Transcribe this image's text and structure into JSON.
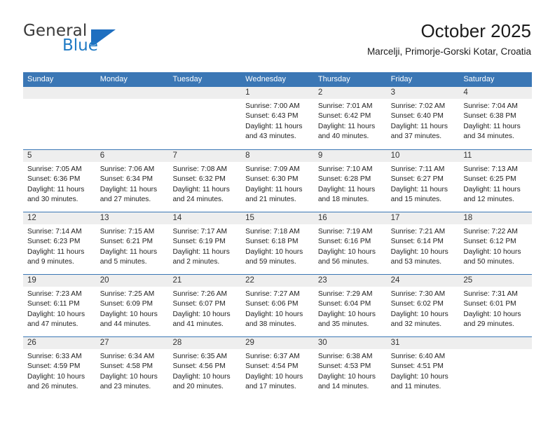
{
  "brand": {
    "name_dark": "General",
    "name_blue": "Blue",
    "mark": "triangle-logo",
    "color_dark": "#3a3a3a",
    "color_blue": "#1f7ac4"
  },
  "header": {
    "title": "October 2025",
    "subtitle": "Marcelji, Primorje-Gorski Kotar, Croatia"
  },
  "theme": {
    "header_blue": "#3b77b5",
    "daynum_band": "#eeeeee",
    "text": "#222222"
  },
  "calendar": {
    "weekday_headers": [
      "Sunday",
      "Monday",
      "Tuesday",
      "Wednesday",
      "Thursday",
      "Friday",
      "Saturday"
    ],
    "labels": {
      "sunrise": "Sunrise:",
      "sunset": "Sunset:",
      "daylight": "Daylight:"
    },
    "weeks": [
      [
        {
          "day": "",
          "sunrise": "",
          "sunset": "",
          "daylight": ""
        },
        {
          "day": "",
          "sunrise": "",
          "sunset": "",
          "daylight": ""
        },
        {
          "day": "",
          "sunrise": "",
          "sunset": "",
          "daylight": ""
        },
        {
          "day": "1",
          "sunrise": "Sunrise: 7:00 AM",
          "sunset": "Sunset: 6:43 PM",
          "daylight": "Daylight: 11 hours and 43 minutes."
        },
        {
          "day": "2",
          "sunrise": "Sunrise: 7:01 AM",
          "sunset": "Sunset: 6:42 PM",
          "daylight": "Daylight: 11 hours and 40 minutes."
        },
        {
          "day": "3",
          "sunrise": "Sunrise: 7:02 AM",
          "sunset": "Sunset: 6:40 PM",
          "daylight": "Daylight: 11 hours and 37 minutes."
        },
        {
          "day": "4",
          "sunrise": "Sunrise: 7:04 AM",
          "sunset": "Sunset: 6:38 PM",
          "daylight": "Daylight: 11 hours and 34 minutes."
        }
      ],
      [
        {
          "day": "5",
          "sunrise": "Sunrise: 7:05 AM",
          "sunset": "Sunset: 6:36 PM",
          "daylight": "Daylight: 11 hours and 30 minutes."
        },
        {
          "day": "6",
          "sunrise": "Sunrise: 7:06 AM",
          "sunset": "Sunset: 6:34 PM",
          "daylight": "Daylight: 11 hours and 27 minutes."
        },
        {
          "day": "7",
          "sunrise": "Sunrise: 7:08 AM",
          "sunset": "Sunset: 6:32 PM",
          "daylight": "Daylight: 11 hours and 24 minutes."
        },
        {
          "day": "8",
          "sunrise": "Sunrise: 7:09 AM",
          "sunset": "Sunset: 6:30 PM",
          "daylight": "Daylight: 11 hours and 21 minutes."
        },
        {
          "day": "9",
          "sunrise": "Sunrise: 7:10 AM",
          "sunset": "Sunset: 6:28 PM",
          "daylight": "Daylight: 11 hours and 18 minutes."
        },
        {
          "day": "10",
          "sunrise": "Sunrise: 7:11 AM",
          "sunset": "Sunset: 6:27 PM",
          "daylight": "Daylight: 11 hours and 15 minutes."
        },
        {
          "day": "11",
          "sunrise": "Sunrise: 7:13 AM",
          "sunset": "Sunset: 6:25 PM",
          "daylight": "Daylight: 11 hours and 12 minutes."
        }
      ],
      [
        {
          "day": "12",
          "sunrise": "Sunrise: 7:14 AM",
          "sunset": "Sunset: 6:23 PM",
          "daylight": "Daylight: 11 hours and 9 minutes."
        },
        {
          "day": "13",
          "sunrise": "Sunrise: 7:15 AM",
          "sunset": "Sunset: 6:21 PM",
          "daylight": "Daylight: 11 hours and 5 minutes."
        },
        {
          "day": "14",
          "sunrise": "Sunrise: 7:17 AM",
          "sunset": "Sunset: 6:19 PM",
          "daylight": "Daylight: 11 hours and 2 minutes."
        },
        {
          "day": "15",
          "sunrise": "Sunrise: 7:18 AM",
          "sunset": "Sunset: 6:18 PM",
          "daylight": "Daylight: 10 hours and 59 minutes."
        },
        {
          "day": "16",
          "sunrise": "Sunrise: 7:19 AM",
          "sunset": "Sunset: 6:16 PM",
          "daylight": "Daylight: 10 hours and 56 minutes."
        },
        {
          "day": "17",
          "sunrise": "Sunrise: 7:21 AM",
          "sunset": "Sunset: 6:14 PM",
          "daylight": "Daylight: 10 hours and 53 minutes."
        },
        {
          "day": "18",
          "sunrise": "Sunrise: 7:22 AM",
          "sunset": "Sunset: 6:12 PM",
          "daylight": "Daylight: 10 hours and 50 minutes."
        }
      ],
      [
        {
          "day": "19",
          "sunrise": "Sunrise: 7:23 AM",
          "sunset": "Sunset: 6:11 PM",
          "daylight": "Daylight: 10 hours and 47 minutes."
        },
        {
          "day": "20",
          "sunrise": "Sunrise: 7:25 AM",
          "sunset": "Sunset: 6:09 PM",
          "daylight": "Daylight: 10 hours and 44 minutes."
        },
        {
          "day": "21",
          "sunrise": "Sunrise: 7:26 AM",
          "sunset": "Sunset: 6:07 PM",
          "daylight": "Daylight: 10 hours and 41 minutes."
        },
        {
          "day": "22",
          "sunrise": "Sunrise: 7:27 AM",
          "sunset": "Sunset: 6:06 PM",
          "daylight": "Daylight: 10 hours and 38 minutes."
        },
        {
          "day": "23",
          "sunrise": "Sunrise: 7:29 AM",
          "sunset": "Sunset: 6:04 PM",
          "daylight": "Daylight: 10 hours and 35 minutes."
        },
        {
          "day": "24",
          "sunrise": "Sunrise: 7:30 AM",
          "sunset": "Sunset: 6:02 PM",
          "daylight": "Daylight: 10 hours and 32 minutes."
        },
        {
          "day": "25",
          "sunrise": "Sunrise: 7:31 AM",
          "sunset": "Sunset: 6:01 PM",
          "daylight": "Daylight: 10 hours and 29 minutes."
        }
      ],
      [
        {
          "day": "26",
          "sunrise": "Sunrise: 6:33 AM",
          "sunset": "Sunset: 4:59 PM",
          "daylight": "Daylight: 10 hours and 26 minutes."
        },
        {
          "day": "27",
          "sunrise": "Sunrise: 6:34 AM",
          "sunset": "Sunset: 4:58 PM",
          "daylight": "Daylight: 10 hours and 23 minutes."
        },
        {
          "day": "28",
          "sunrise": "Sunrise: 6:35 AM",
          "sunset": "Sunset: 4:56 PM",
          "daylight": "Daylight: 10 hours and 20 minutes."
        },
        {
          "day": "29",
          "sunrise": "Sunrise: 6:37 AM",
          "sunset": "Sunset: 4:54 PM",
          "daylight": "Daylight: 10 hours and 17 minutes."
        },
        {
          "day": "30",
          "sunrise": "Sunrise: 6:38 AM",
          "sunset": "Sunset: 4:53 PM",
          "daylight": "Daylight: 10 hours and 14 minutes."
        },
        {
          "day": "31",
          "sunrise": "Sunrise: 6:40 AM",
          "sunset": "Sunset: 4:51 PM",
          "daylight": "Daylight: 10 hours and 11 minutes."
        },
        {
          "day": "",
          "sunrise": "",
          "sunset": "",
          "daylight": ""
        }
      ]
    ]
  }
}
